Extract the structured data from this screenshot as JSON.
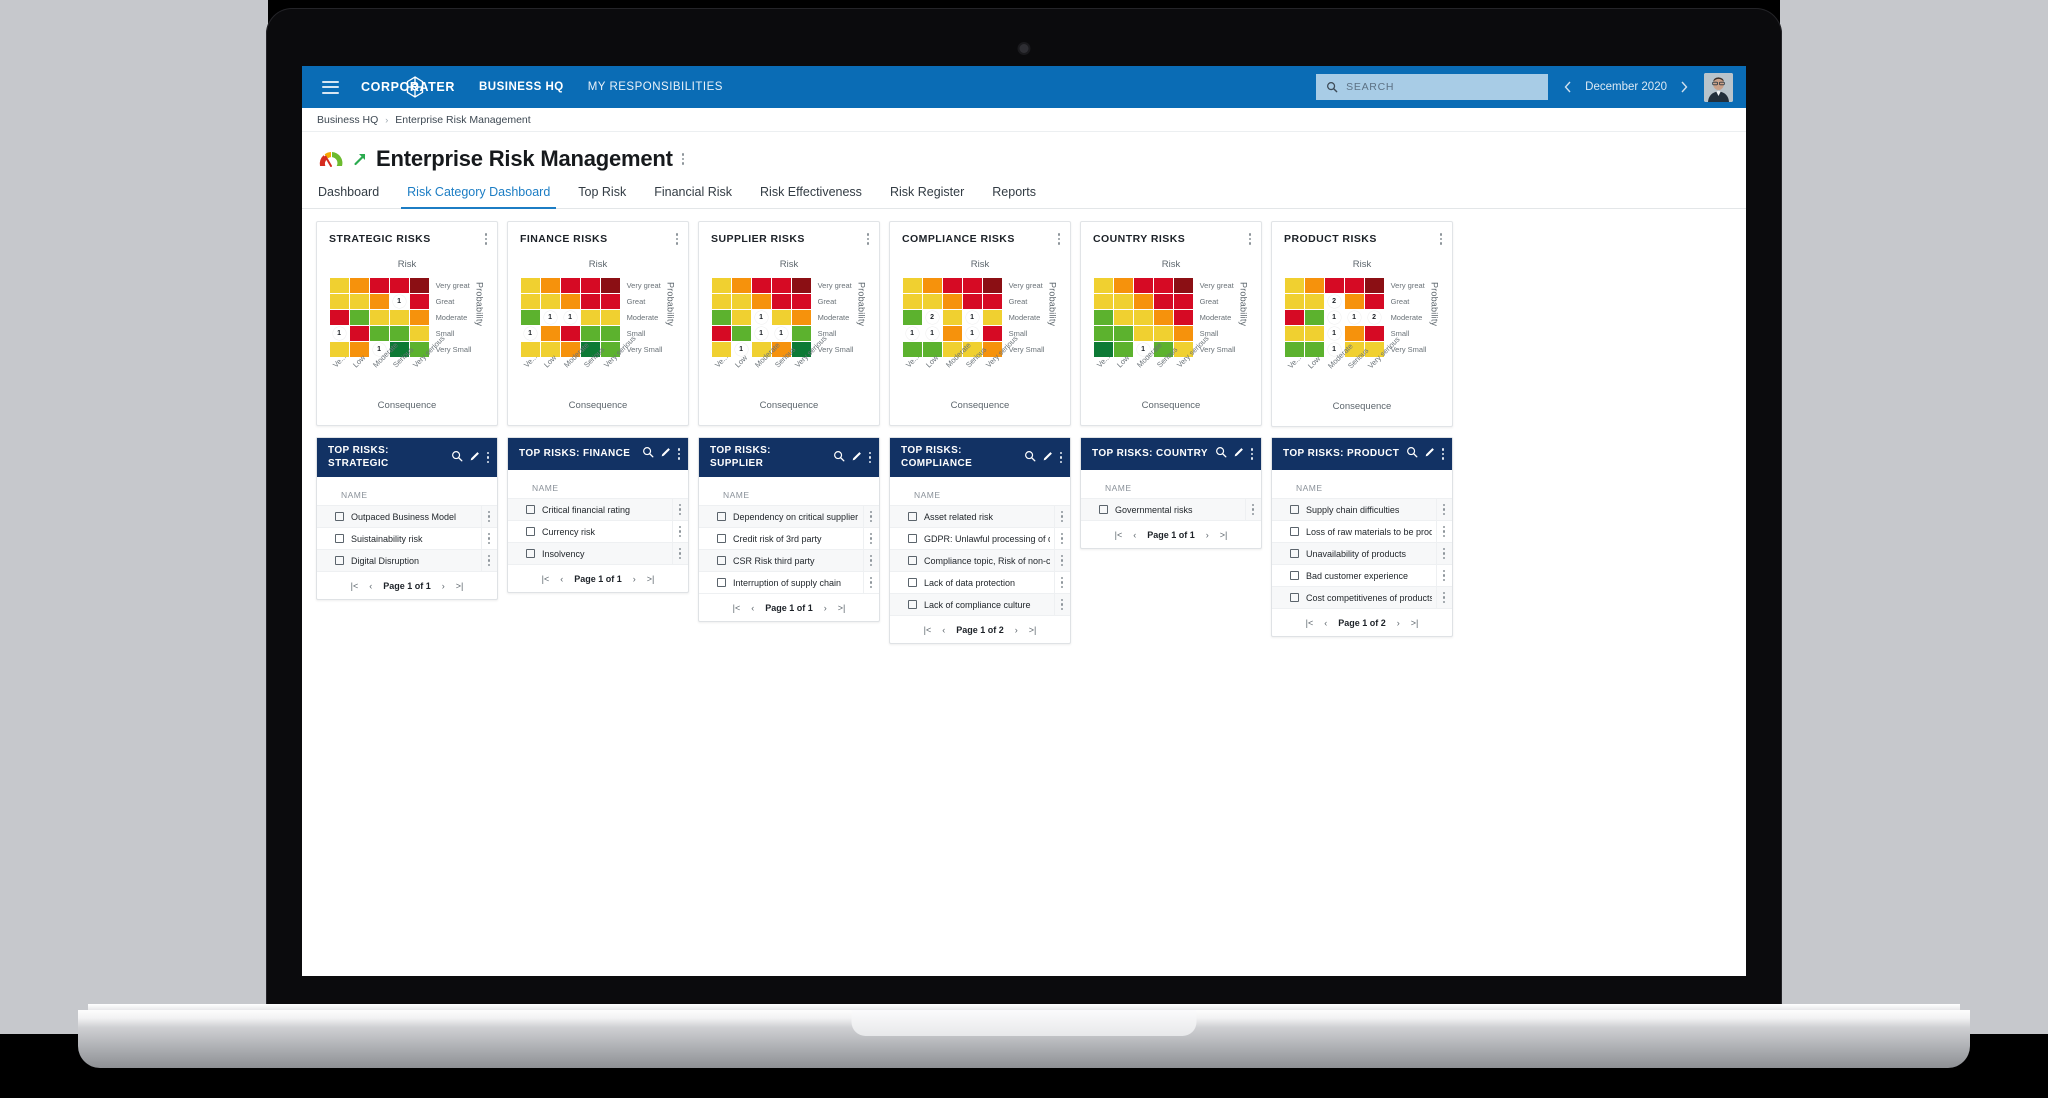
{
  "topbar": {
    "menu_icon": "hamburger-menu-icon",
    "brand": "CORPORATER",
    "nav": [
      {
        "label": "BUSINESS HQ",
        "bold": true
      },
      {
        "label": "MY RESPONSIBILITIES",
        "bold": false
      }
    ],
    "search": {
      "placeholder": "SEARCH",
      "value": "",
      "icon": "search-icon"
    },
    "date": {
      "prev_icon": "chevron-left-icon",
      "label": "December 2020",
      "next_icon": "chevron-right-icon"
    },
    "avatar": "user-avatar"
  },
  "breadcrumb": {
    "root": "Business HQ",
    "separator": "›",
    "current": "Enterprise Risk Management"
  },
  "page": {
    "title": "Enterprise Risk Management",
    "icon": "risk-gauge-icon",
    "trend_icon": "arrow-up-right-icon",
    "menu_icon": "kebab-menu-icon"
  },
  "tabs": [
    {
      "label": "Dashboard",
      "active": false
    },
    {
      "label": "Risk Category Dashboard",
      "active": true
    },
    {
      "label": "Top Risk",
      "active": false
    },
    {
      "label": "Financial Risk",
      "active": false
    },
    {
      "label": "Risk Effectiveness",
      "active": false
    },
    {
      "label": "Risk Register",
      "active": false
    },
    {
      "label": "Reports",
      "active": false
    }
  ],
  "matrix_common": {
    "risk_label": "Risk",
    "probability_label": "Probability",
    "consequence_label": "Consequence",
    "y_labels": [
      "Very great",
      "Great",
      "Moderate",
      "Small",
      "Very Small"
    ],
    "x_labels": [
      "Ve...",
      "Low",
      "Moderate",
      "Serious",
      "Very serious"
    ],
    "palette": {
      "dark_green": "#0d7a35",
      "green": "#5cb22e",
      "yellow": "#f0d030",
      "orange": "#f6920c",
      "red": "#d60a24",
      "dark_red": "#8b0f14"
    },
    "color_grid": [
      [
        "yellow",
        "orange",
        "red",
        "red",
        "dark_red"
      ],
      [
        "yellow",
        "yellow",
        "orange",
        "red",
        "red"
      ],
      [
        "green",
        "yellow",
        "yellow",
        "orange",
        "red"
      ],
      [
        "green",
        "green",
        "yellow",
        "yellow",
        "orange"
      ],
      [
        "dark_green",
        "green",
        "green",
        "yellow",
        "yellow"
      ]
    ]
  },
  "chart_data": [
    {
      "type": "heatmap",
      "title": "STRATEGIC RISKS",
      "xlabel": "Consequence",
      "ylabel": "Probability",
      "subtitle": "Risk",
      "x": [
        "Ve...",
        "Low",
        "Moderate",
        "Serious",
        "Very serious"
      ],
      "y": [
        "Very great",
        "Great",
        "Moderate",
        "Small",
        "Very Small"
      ],
      "bubbles": [
        {
          "row": 1,
          "col": 3,
          "value": 1
        },
        {
          "row": 3,
          "col": 0,
          "value": 1
        },
        {
          "row": 4,
          "col": 2,
          "value": 1
        }
      ]
    },
    {
      "type": "heatmap",
      "title": "FINANCE RISKS",
      "xlabel": "Consequence",
      "ylabel": "Probability",
      "subtitle": "Risk",
      "x": [
        "Ve...",
        "Low",
        "Moderate",
        "Serious",
        "Very serious"
      ],
      "y": [
        "Very great",
        "Great",
        "Moderate",
        "Small",
        "Very Small"
      ],
      "bubbles": [
        {
          "row": 2,
          "col": 1,
          "value": 1
        },
        {
          "row": 2,
          "col": 2,
          "value": 1
        },
        {
          "row": 3,
          "col": 0,
          "value": 1
        }
      ]
    },
    {
      "type": "heatmap",
      "title": "SUPPLIER RISKS",
      "xlabel": "Consequence",
      "ylabel": "Probability",
      "subtitle": "Risk",
      "x": [
        "Ve...",
        "Low",
        "Moderate",
        "Serious",
        "Very serious"
      ],
      "y": [
        "Very great",
        "Great",
        "Moderate",
        "Small",
        "Very Small"
      ],
      "bubbles": [
        {
          "row": 2,
          "col": 2,
          "value": 1
        },
        {
          "row": 3,
          "col": 2,
          "value": 1
        },
        {
          "row": 3,
          "col": 3,
          "value": 1
        },
        {
          "row": 4,
          "col": 1,
          "value": 1
        }
      ]
    },
    {
      "type": "heatmap",
      "title": "COMPLIANCE RISKS",
      "xlabel": "Consequence",
      "ylabel": "Probability",
      "subtitle": "Risk",
      "x": [
        "Ve...",
        "Low",
        "Moderate",
        "Serious",
        "Very serious"
      ],
      "y": [
        "Very great",
        "Great",
        "Moderate",
        "Small",
        "Very Small"
      ],
      "bubbles": [
        {
          "row": 2,
          "col": 1,
          "value": 2
        },
        {
          "row": 2,
          "col": 3,
          "value": 1
        },
        {
          "row": 3,
          "col": 0,
          "value": 1
        },
        {
          "row": 3,
          "col": 1,
          "value": 1
        },
        {
          "row": 3,
          "col": 3,
          "value": 1
        }
      ]
    },
    {
      "type": "heatmap",
      "title": "COUNTRY RISKS",
      "xlabel": "Consequence",
      "ylabel": "Probability",
      "subtitle": "Risk",
      "x": [
        "Ve...",
        "Low",
        "Moderate",
        "Serious",
        "Very serious"
      ],
      "y": [
        "Very great",
        "Great",
        "Moderate",
        "Small",
        "Very Small"
      ],
      "bubbles": [
        {
          "row": 4,
          "col": 2,
          "value": 1
        }
      ]
    },
    {
      "type": "heatmap",
      "title": "PRODUCT RISKS",
      "xlabel": "Consequence",
      "ylabel": "Probability",
      "subtitle": "Risk",
      "x": [
        "Ve...",
        "Low",
        "Moderate",
        "Serious",
        "Very serious"
      ],
      "y": [
        "Very great",
        "Great",
        "Moderate",
        "Small",
        "Very Small"
      ],
      "bubbles": [
        {
          "row": 1,
          "col": 2,
          "value": 2
        },
        {
          "row": 2,
          "col": 2,
          "value": 1
        },
        {
          "row": 2,
          "col": 3,
          "value": 1
        },
        {
          "row": 2,
          "col": 4,
          "value": 2
        },
        {
          "row": 3,
          "col": 2,
          "value": 1
        },
        {
          "row": 4,
          "col": 2,
          "value": 1
        }
      ]
    }
  ],
  "lists": [
    {
      "title": "TOP RISKS: STRATEGIC",
      "column_header": "NAME",
      "rows": [
        "Outpaced Business Model",
        "Suistainability risk",
        "Digital Disruption"
      ],
      "pager": {
        "first": "|<",
        "prev": "‹",
        "label": "Page 1 of 1",
        "next": "›",
        "last": ">|"
      }
    },
    {
      "title": "TOP RISKS: FINANCE",
      "column_header": "NAME",
      "rows": [
        "Critical financial rating",
        "Currency risk",
        "Insolvency"
      ],
      "pager": {
        "first": "|<",
        "prev": "‹",
        "label": "Page 1 of 1",
        "next": "›",
        "last": ">|"
      }
    },
    {
      "title": "TOP RISKS: SUPPLIER",
      "column_header": "NAME",
      "rows": [
        "Dependency on critical supplier",
        "Credit risk of 3rd party",
        "CSR Risk third party",
        "Interruption of supply chain"
      ],
      "pager": {
        "first": "|<",
        "prev": "‹",
        "label": "Page 1 of 1",
        "next": "›",
        "last": ">|"
      }
    },
    {
      "title": "TOP RISKS: COMPLIANCE",
      "column_header": "NAME",
      "rows": [
        "Asset related risk",
        "GDPR: Unlawful processing of data",
        "Compliance topic, Risk of non-compliance",
        "Lack of data protection",
        "Lack of compliance culture"
      ],
      "pager": {
        "first": "|<",
        "prev": "‹",
        "label": "Page 1 of 2",
        "next": "›",
        "last": ">|"
      }
    },
    {
      "title": "TOP RISKS: COUNTRY",
      "column_header": "NAME",
      "rows": [
        "Governmental risks"
      ],
      "pager": {
        "first": "|<",
        "prev": "‹",
        "label": "Page 1 of 1",
        "next": "›",
        "last": ">|"
      }
    },
    {
      "title": "TOP RISKS: PRODUCT",
      "column_header": "NAME",
      "rows": [
        "Supply chain difficulties",
        "Loss of raw materials to be produced",
        "Unavailability of products",
        "Bad customer experience",
        "Cost competitivenes of products"
      ],
      "pager": {
        "first": "|<",
        "prev": "‹",
        "label": "Page 1 of 2",
        "next": "›",
        "last": ">|"
      }
    }
  ],
  "list_icons": {
    "search": "search-icon",
    "edit": "pencil-icon",
    "menu": "kebab-menu-icon"
  },
  "colors": {
    "topbar": "#0a6cb5",
    "list_header": "#123264",
    "accent": "#1c7dc4",
    "search_bg": "#a8cce6"
  }
}
